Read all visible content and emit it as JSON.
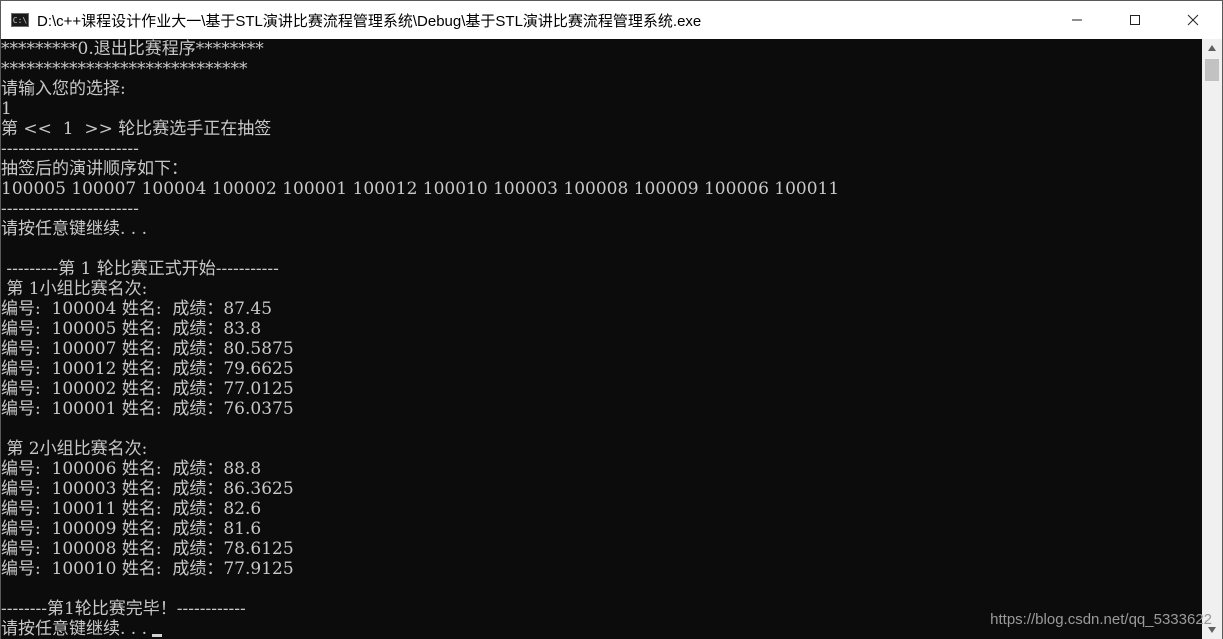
{
  "window": {
    "title": "D:\\c++课程设计作业大一\\基于STL演讲比赛流程管理系统\\Debug\\基于STL演讲比赛流程管理系统.exe",
    "icon": "console-app-icon",
    "icon_text": "C:\\",
    "controls": [
      "minimize-icon",
      "maximize-icon",
      "close-icon"
    ]
  },
  "console": {
    "lines": [
      "*********0.退出比赛程序********",
      "*****************************",
      "请输入您的选择:",
      "1",
      "第 <<  1  >> 轮比赛选手正在抽签",
      "------------------------",
      "抽签后的演讲顺序如下：",
      "100005 100007 100004 100002 100001 100012 100010 100003 100008 100009 100006 100011",
      "------------------------",
      "请按任意键继续. . .",
      "",
      " ---------第 1 轮比赛正式开始-----------",
      " 第 1小组比赛名次:",
      "编号:  100004 姓名:  成绩：87.45",
      "编号:  100005 姓名:  成绩：83.8",
      "编号:  100007 姓名:  成绩：80.5875",
      "编号:  100012 姓名:  成绩：79.6625",
      "编号:  100002 姓名:  成绩：77.0125",
      "编号:  100001 姓名:  成绩：76.0375",
      "",
      " 第 2小组比赛名次:",
      "编号:  100006 姓名:  成绩：88.8",
      "编号:  100003 姓名:  成绩：86.3625",
      "编号:  100011 姓名:  成绩：82.6",
      "编号:  100009 姓名:  成绩：81.6",
      "编号:  100008 姓名:  成绩：78.6125",
      "编号:  100010 姓名:  成绩：77.9125",
      "",
      "--------第1轮比赛完毕！------------"
    ],
    "prompt_line": "请按任意键继续. . . "
  },
  "watermark": "https://blog.csdn.net/qq_5333622",
  "colors": {
    "console_bg": "#0c0c0c",
    "console_text": "#c8c8c8",
    "titlebar_bg": "#ffffff"
  }
}
